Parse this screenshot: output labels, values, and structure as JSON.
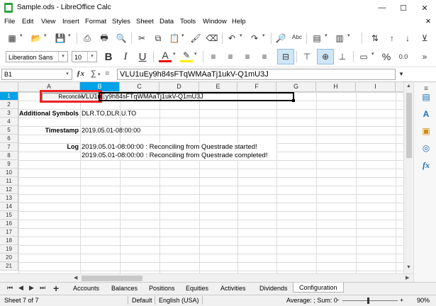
{
  "window": {
    "title": "Sample.ods - LibreOffice Calc",
    "minimize": "—",
    "maximize": "☐",
    "close": "✕"
  },
  "menubar": {
    "items": [
      "File",
      "Edit",
      "View",
      "Insert",
      "Format",
      "Styles",
      "Sheet",
      "Data",
      "Tools",
      "Window",
      "Help"
    ],
    "close": "✕"
  },
  "formatting": {
    "font_name": "Liberation Sans",
    "font_size": "10",
    "bold": "B",
    "italic": "I",
    "underline": "U",
    "font_color_letter": "A",
    "percent": "%",
    "number_format": "0.0"
  },
  "formula_bar": {
    "cell_ref": "B1",
    "content": "VLU1uEy9h84sFTqWMAaTj1ukV-Q1mU3J"
  },
  "columns": [
    "A",
    "B",
    "C",
    "D",
    "E",
    "F",
    "G",
    "H",
    "I"
  ],
  "active_column": "B",
  "rows": [
    "1",
    "2",
    "3",
    "4",
    "5",
    "6",
    "7",
    "8",
    "9",
    "10",
    "11",
    "12",
    "13",
    "14",
    "15",
    "16",
    "17",
    "18",
    "19",
    "20",
    "21"
  ],
  "active_row": "1",
  "sheet": {
    "reconcile_button": "Reconcile",
    "b1": "VLU1uEy9h84sFTqWMAaTj1ukV-Q1mU3J",
    "additional_symbols_label": "Additional Symbols",
    "additional_symbols_value": "DLR.TO,DLR.U.TO",
    "timestamp_label": "Timestamp",
    "timestamp_value": "2019.05.01-08:00:00",
    "log_label": "Log",
    "log_line1": "2019.05.01-08:00:00 : Reconciling from Questrade started!",
    "log_line2": "2019.05.01-08:00:00 : Reconciling from Questrade completed!"
  },
  "tabs": [
    "Accounts",
    "Balances",
    "Positions",
    "Equities",
    "Activities",
    "Dividends",
    "Configuration"
  ],
  "active_tab": "Configuration",
  "statusbar": {
    "sheet": "Sheet 7 of 7",
    "style": "Default",
    "language": "English (USA)",
    "summary": "Average: ; Sum: 0",
    "zoom": "90%"
  }
}
